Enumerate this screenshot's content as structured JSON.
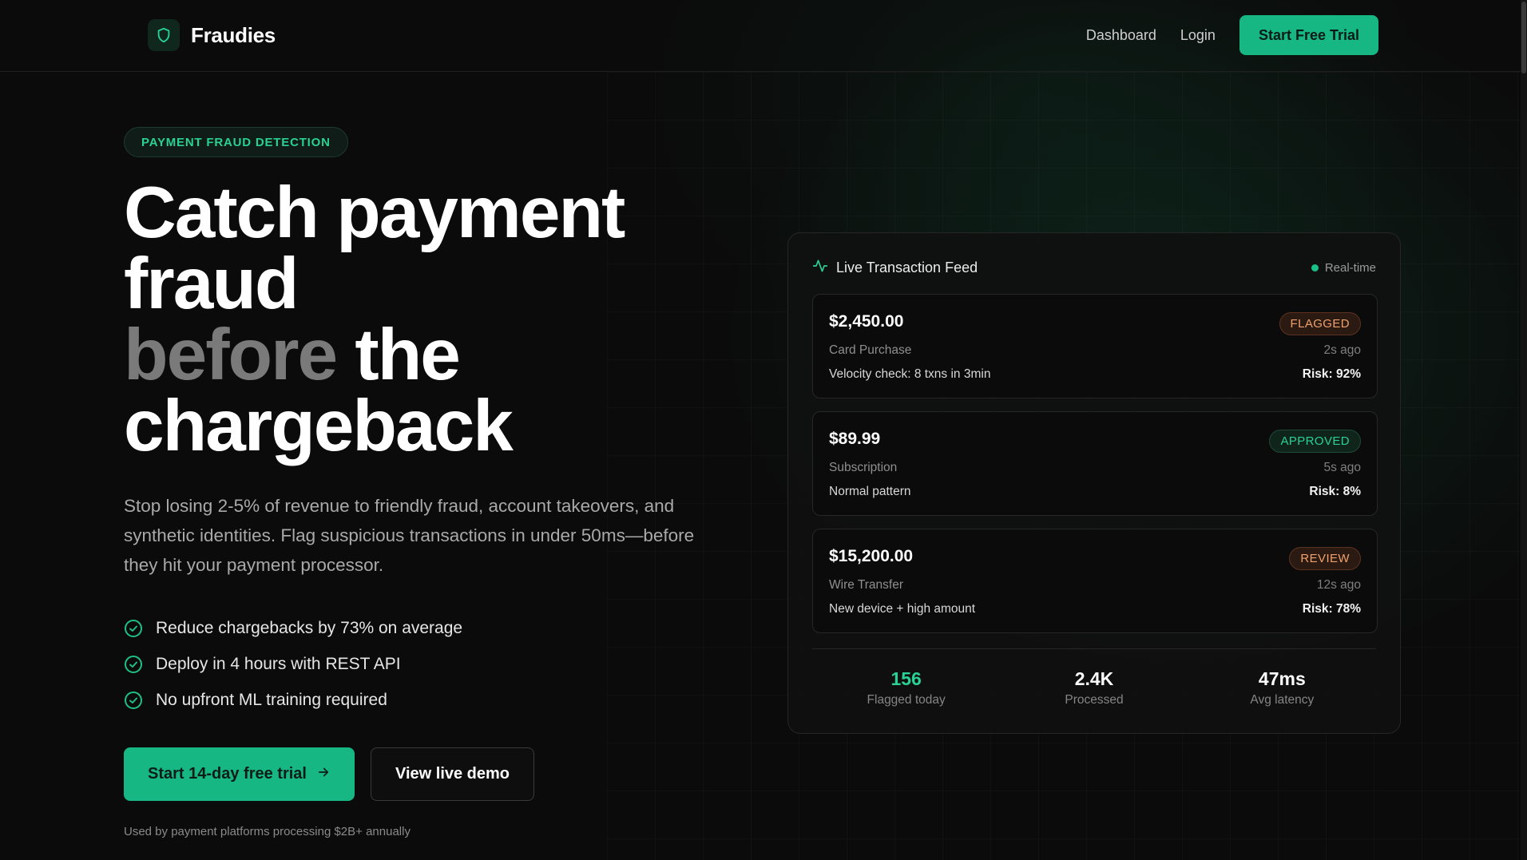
{
  "brand": {
    "name": "Fraudies",
    "icon": "shield-icon"
  },
  "nav": {
    "dashboard_label": "Dashboard",
    "login_label": "Login",
    "trial_label": "Start Free Trial"
  },
  "hero": {
    "badge": "PAYMENT FRAUD DETECTION",
    "headline_line1": "Catch payment",
    "headline_line2": "fraud",
    "headline_dim": "before",
    "headline_line3_rest": " the",
    "headline_line4": "chargeback",
    "subhead": "Stop losing 2-5% of revenue to friendly fraud, account takeovers, and synthetic identities. Flag suspicious transactions in under 50ms—before they hit your payment processor.",
    "features": [
      "Reduce chargebacks by 73% on average",
      "Deploy in 4 hours with REST API",
      "No upfront ML training required"
    ],
    "cta_primary": "Start 14-day free trial",
    "cta_secondary": "View live demo",
    "social_proof": "Used by payment platforms processing $2B+ annually"
  },
  "feed": {
    "title": "Live Transaction Feed",
    "live_label": "Real-time",
    "transactions": [
      {
        "amount": "$2,450.00",
        "status": "FLAGGED",
        "type": "Card Purchase",
        "time": "2s ago",
        "note": "Velocity check: 8 txns in 3min",
        "risk": "Risk: 92%"
      },
      {
        "amount": "$89.99",
        "status": "APPROVED",
        "type": "Subscription",
        "time": "5s ago",
        "note": "Normal pattern",
        "risk": "Risk: 8%"
      },
      {
        "amount": "$15,200.00",
        "status": "REVIEW",
        "type": "Wire Transfer",
        "time": "12s ago",
        "note": "New device + high amount",
        "risk": "Risk: 78%"
      }
    ],
    "stats": [
      {
        "value": "156",
        "label": "Flagged today"
      },
      {
        "value": "2.4K",
        "label": "Processed"
      },
      {
        "value": "47ms",
        "label": "Avg latency"
      }
    ]
  },
  "colors": {
    "accent": "#17b784",
    "background": "#0b0b0b",
    "flagged": "#f0a16b",
    "approved": "#2ad194"
  }
}
